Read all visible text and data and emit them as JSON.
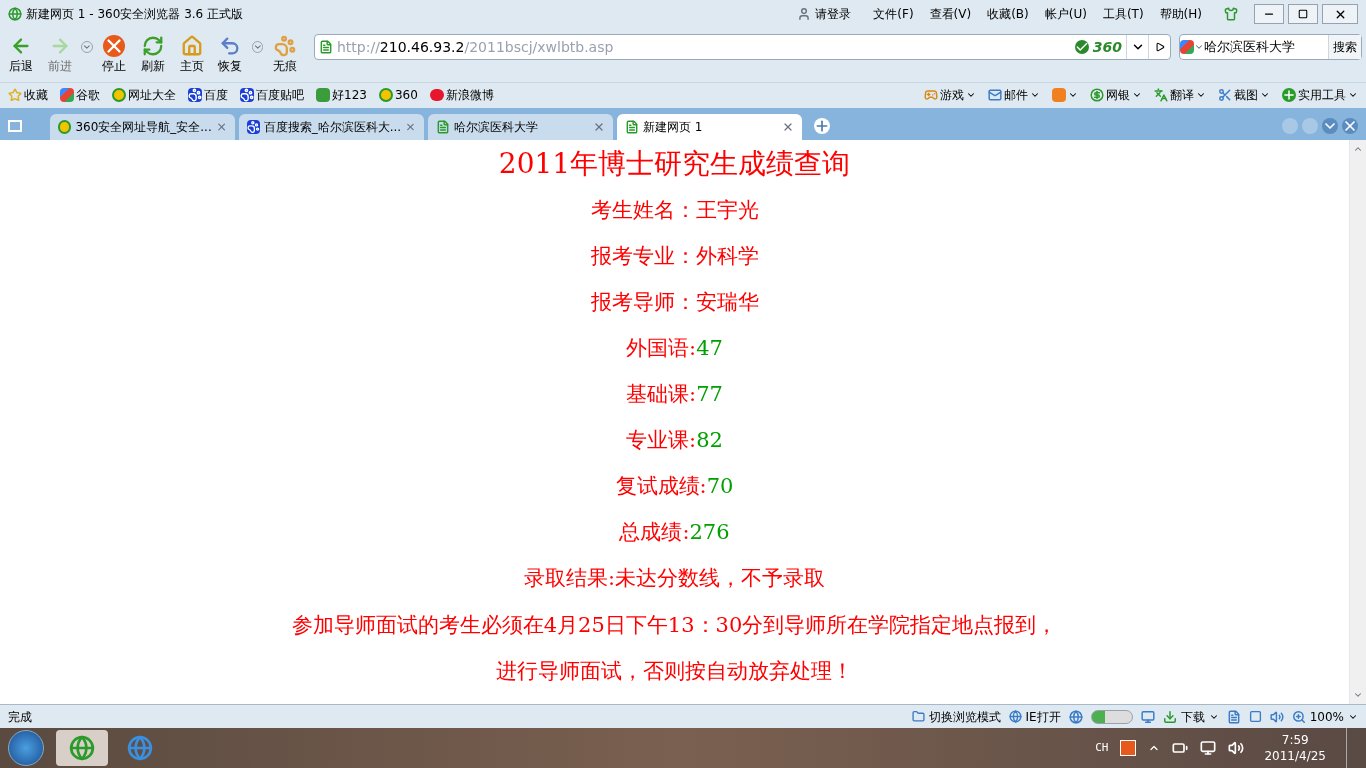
{
  "window": {
    "title": "新建网页 1 - 360安全浏览器 3.6 正式版"
  },
  "account": {
    "label": "请登录"
  },
  "menu": [
    "文件(F)",
    "查看(V)",
    "收藏(B)",
    "帐户(U)",
    "工具(T)",
    "帮助(H)"
  ],
  "toolbar": [
    {
      "label": "后退",
      "kind": "back",
      "disabled": false
    },
    {
      "label": "前进",
      "kind": "forward",
      "disabled": true
    },
    {
      "label": "停止",
      "kind": "stop",
      "disabled": false
    },
    {
      "label": "刷新",
      "kind": "refresh",
      "disabled": false
    },
    {
      "label": "主页",
      "kind": "home",
      "disabled": false
    },
    {
      "label": "恢复",
      "kind": "restore",
      "disabled": false
    },
    {
      "label": "无痕",
      "kind": "private",
      "disabled": false
    }
  ],
  "address": {
    "scheme": "http://",
    "host": "210.46.93.2",
    "path": "/2011bscj/xwlbtb.asp",
    "badge": "360"
  },
  "search": {
    "value": "哈尔滨医科大学",
    "button": "搜索"
  },
  "bookmarks": [
    {
      "label": "收藏",
      "kind": "favorites"
    },
    {
      "label": "谷歌",
      "kind": "google"
    },
    {
      "label": "网址大全",
      "kind": "safe"
    },
    {
      "label": "百度",
      "kind": "paw"
    },
    {
      "label": "百度贴吧",
      "kind": "paw"
    },
    {
      "label": "好123",
      "kind": "hao"
    },
    {
      "label": "360",
      "kind": "safe"
    },
    {
      "label": "新浪微博",
      "kind": "weibo"
    }
  ],
  "tools": [
    {
      "label": "游戏",
      "kind": "game"
    },
    {
      "label": "邮件",
      "kind": "mail"
    },
    {
      "kind": "group"
    },
    {
      "label": "网银",
      "kind": "bank"
    },
    {
      "label": "翻译",
      "kind": "translate"
    },
    {
      "label": "截图",
      "kind": "screenshot"
    },
    {
      "label": "实用工具",
      "kind": "plus"
    }
  ],
  "tabs": [
    {
      "label": "360安全网址导航_安全...",
      "kind": "safe",
      "selected": false
    },
    {
      "label": "百度搜索_哈尔滨医科大...",
      "kind": "paw",
      "selected": false
    },
    {
      "label": "哈尔滨医科大学",
      "kind": "page",
      "selected": false
    },
    {
      "label": "新建网页 1",
      "kind": "page",
      "selected": true
    }
  ],
  "page": {
    "title": "2011年博士研究生成绩查询",
    "fields": [
      {
        "label": "考生姓名：",
        "value": "王宇光",
        "color": "#ff0000"
      },
      {
        "label": "报考专业：",
        "value": "外科学",
        "color": "#ff0000"
      },
      {
        "label": "报考导师：",
        "value": "安瑞华",
        "color": "#ff0000"
      },
      {
        "label": "外国语:",
        "value": "47",
        "color": "#00a000"
      },
      {
        "label": "基础课:",
        "value": "77",
        "color": "#00a000"
      },
      {
        "label": "专业课:",
        "value": "82",
        "color": "#00a000"
      },
      {
        "label": "复试成绩:",
        "value": "70",
        "color": "#00a000"
      },
      {
        "label": "总成绩:",
        "value": "276",
        "color": "#00a000"
      },
      {
        "label": "录取结果:",
        "value": "未达分数线，不予录取",
        "color": "#ff0000"
      }
    ],
    "notice": [
      "参加导师面试的考生必须在4月25日下午13：30分到导师所在学院指定地点报到，",
      "进行导师面试，否则按自动放弃处理！"
    ]
  },
  "status": {
    "text": "完成",
    "mode": "切换浏览模式",
    "ie": "IE打开",
    "switch_on": true,
    "download": "下载",
    "zoom": "100%"
  },
  "taskbar": {
    "lang": "CH",
    "time": "7:59",
    "date": "2011/4/25"
  }
}
